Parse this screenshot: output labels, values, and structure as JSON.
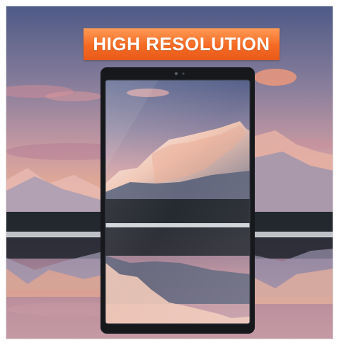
{
  "banner": {
    "text": "HIGH RESOLUTION",
    "color": "#f56a23"
  },
  "scene": {
    "subject": "tablet-screen-protector",
    "background": "mountain-lake-sunset"
  }
}
